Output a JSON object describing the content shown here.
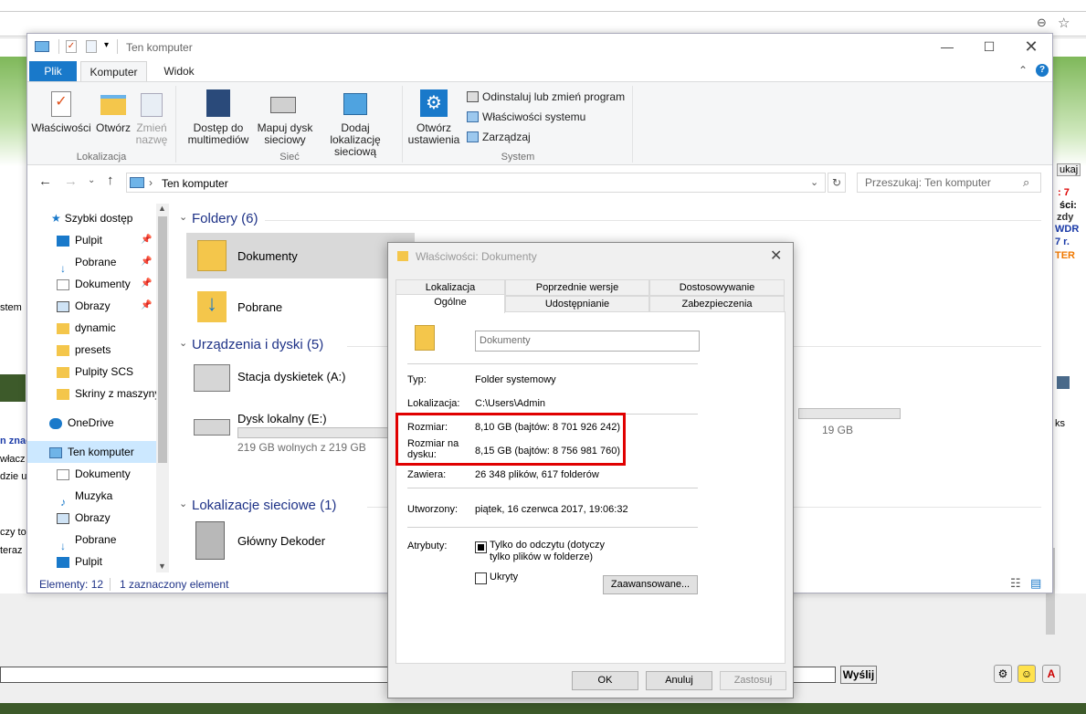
{
  "explorer": {
    "title": "Ten komputer",
    "tabs": [
      "Plik",
      "Komputer",
      "Widok"
    ],
    "ribbon": {
      "location_buttons": [
        "Właściwości",
        "Otwórz",
        "Zmień nazwę"
      ],
      "location_group": "Lokalizacja",
      "network_buttons": [
        "Dostęp do multimediów",
        "Mapuj dysk sieciowy",
        "Dodaj lokalizację sieciową"
      ],
      "network_group": "Sieć",
      "open_settings": "Otwórz ustawienia",
      "system_items": [
        "Odinstaluj lub zmień program",
        "Właściwości systemu",
        "Zarządzaj"
      ],
      "system_group": "System"
    },
    "address": "Ten komputer",
    "search_placeholder": "Przeszukaj: Ten komputer",
    "nav": {
      "quick_access": "Szybki dostęp",
      "quick_items": [
        "Pulpit",
        "Pobrane",
        "Dokumenty",
        "Obrazy",
        "dynamic",
        "presets",
        "Pulpity SCS",
        "Skriny z maszyny"
      ],
      "onedrive": "OneDrive",
      "this_pc": "Ten komputer",
      "pc_items": [
        "Dokumenty",
        "Muzyka",
        "Obrazy",
        "Pobrane",
        "Pulpit"
      ]
    },
    "sections": {
      "folders": "Foldery (6)",
      "folders_items": [
        "Dokumenty",
        "Pobrane"
      ],
      "devices": "Urządzenia i dyski (5)",
      "floppy": "Stacja dyskietek (A:)",
      "local_disk": "Dysk lokalny (E:)",
      "local_disk_free": "219 GB wolnych z 219 GB",
      "right_disk_size": "19 GB",
      "network": "Lokalizacje sieciowe (1)",
      "network_item": "Główny Dekoder"
    },
    "status": {
      "count": "Elementy: 12",
      "selected": "1 zaznaczony element"
    }
  },
  "dialog": {
    "title": "Właściwości: Dokumenty",
    "tabs_row1": [
      "Lokalizacja",
      "Poprzednie wersje",
      "Dostosowywanie"
    ],
    "tabs_row2": [
      "Ogólne",
      "Udostępnianie",
      "Zabezpieczenia"
    ],
    "name": "Dokumenty",
    "type_label": "Typ:",
    "type_value": "Folder systemowy",
    "location_label": "Lokalizacja:",
    "location_value": "C:\\Users\\Admin",
    "size_label": "Rozmiar:",
    "size_value": "8,10 GB (bajtów: 8 701 926 242)",
    "disk_size_label": "Rozmiar na dysku:",
    "disk_size_value": "8,15 GB (bajtów: 8 756 981 760)",
    "contains_label": "Zawiera:",
    "contains_value": "26 348 plików, 617 folderów",
    "created_label": "Utworzony:",
    "created_value": "piątek, 16 czerwca 2017, 19:06:32",
    "attributes_label": "Atrybuty:",
    "readonly_label": "Tylko do odczytu (dotyczy tylko plików w folderze)",
    "hidden_label": "Ukryty",
    "advanced_button": "Zaawansowane...",
    "ok": "OK",
    "cancel": "Anuluj",
    "apply": "Zastosuj"
  },
  "background": {
    "send_button": "Wyślij",
    "left_fragments": [
      "stem",
      "n znac",
      "włacz",
      "dzie u",
      "czy to",
      "teraz"
    ],
    "right_fragments": [
      ": 7",
      "ści:",
      "zdy",
      "WDR",
      "7 r.",
      "TER",
      "ukaj",
      "ks"
    ]
  }
}
